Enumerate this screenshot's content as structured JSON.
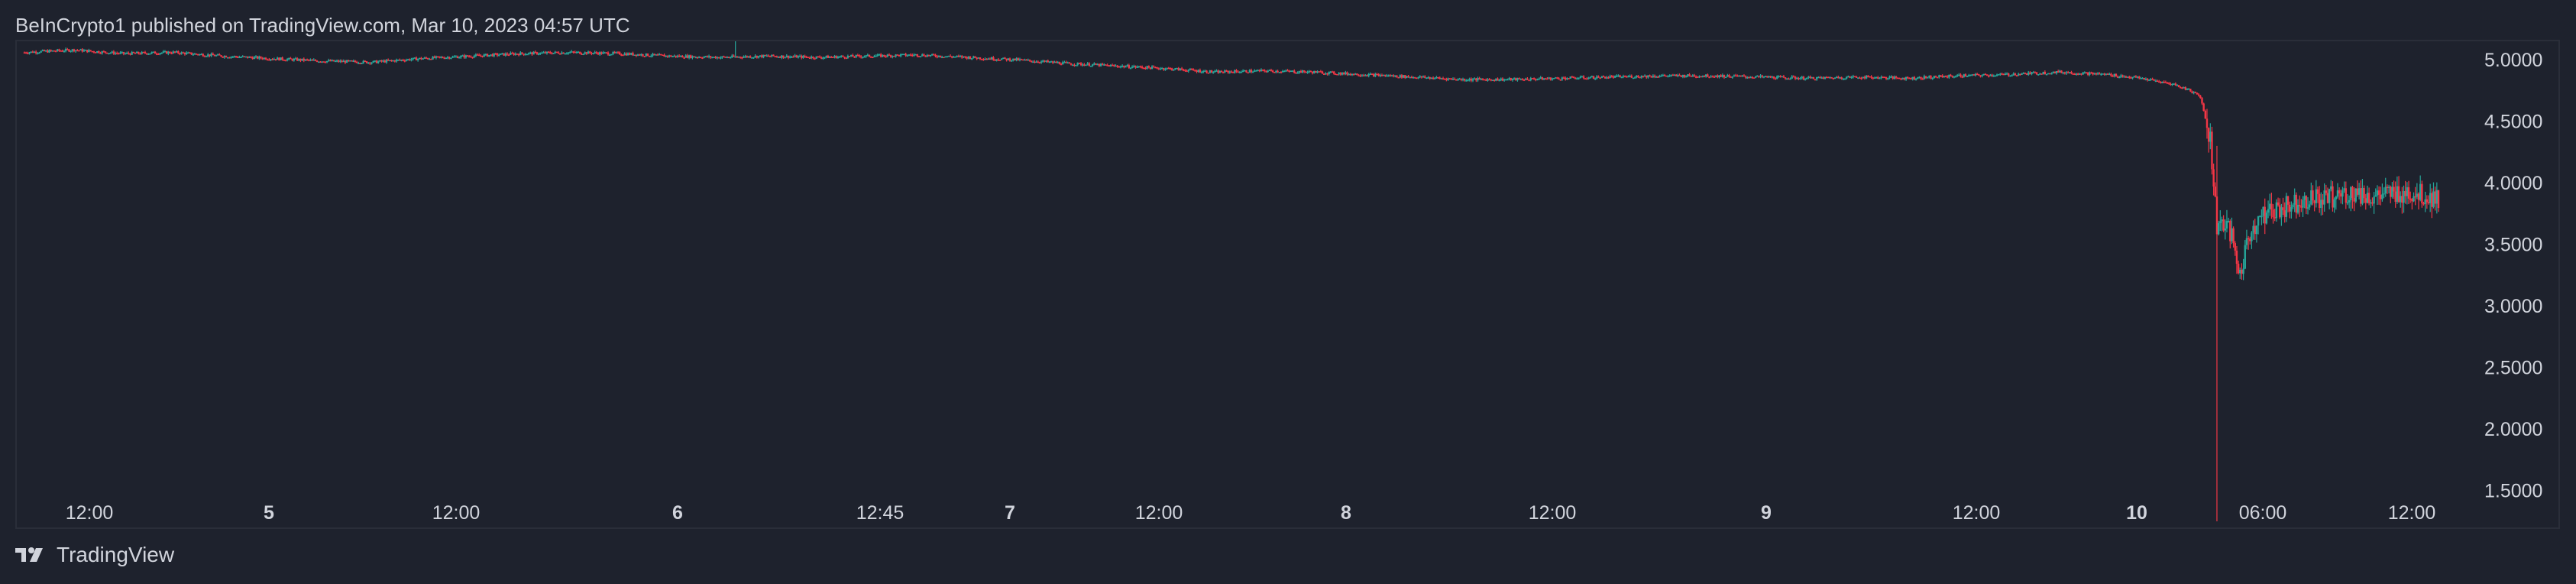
{
  "header": {
    "published_line": "BeInCrypto1 published on TradingView.com, Mar 10, 2023 04:57 UTC"
  },
  "footer": {
    "brand": "TradingView"
  },
  "colors": {
    "background": "#1e222d",
    "up": "#26a69a",
    "down": "#f23645",
    "text": "#d1d4dc",
    "grid_border": "#2a2e39"
  },
  "chart_data": {
    "type": "candlestick",
    "title": "",
    "y_axis_side": "right",
    "ylim": [
      1.2,
      5.15
    ],
    "y_ticks": [
      "5.0000",
      "4.5000",
      "4.0000",
      "3.5000",
      "3.0000",
      "2.5000",
      "2.0000",
      "1.5000"
    ],
    "x_ticks": [
      {
        "label": "12:00",
        "bold": false
      },
      {
        "label": "5",
        "bold": true
      },
      {
        "label": "12:00",
        "bold": false
      },
      {
        "label": "6",
        "bold": true
      },
      {
        "label": "12:45",
        "bold": false
      },
      {
        "label": "7",
        "bold": true
      },
      {
        "label": "12:00",
        "bold": false
      },
      {
        "label": "8",
        "bold": true
      },
      {
        "label": "12:00",
        "bold": false
      },
      {
        "label": "9",
        "bold": true
      },
      {
        "label": "12:00",
        "bold": false
      },
      {
        "label": "10",
        "bold": true
      },
      {
        "label": "06:00",
        "bold": false
      },
      {
        "label": "12:00",
        "bold": false
      }
    ],
    "price_path": [
      [
        0,
        5.06
      ],
      [
        30,
        5.08
      ],
      [
        60,
        5.05
      ],
      [
        90,
        5.06
      ],
      [
        120,
        5.03
      ],
      [
        150,
        5.01
      ],
      [
        180,
        4.99
      ],
      [
        210,
        4.98
      ],
      [
        240,
        5.01
      ],
      [
        270,
        5.03
      ],
      [
        300,
        5.05
      ],
      [
        330,
        5.06
      ],
      [
        360,
        5.05
      ],
      [
        390,
        5.03
      ],
      [
        420,
        5.02
      ],
      [
        450,
        5.03
      ],
      [
        480,
        5.02
      ],
      [
        510,
        5.03
      ],
      [
        540,
        5.04
      ],
      [
        570,
        5.02
      ],
      [
        600,
        5.0
      ],
      [
        630,
        4.97
      ],
      [
        660,
        4.95
      ],
      [
        690,
        4.93
      ],
      [
        720,
        4.9
      ],
      [
        750,
        4.91
      ],
      [
        780,
        4.9
      ],
      [
        810,
        4.88
      ],
      [
        840,
        4.86
      ],
      [
        870,
        4.84
      ],
      [
        900,
        4.84
      ],
      [
        930,
        4.85
      ],
      [
        960,
        4.86
      ],
      [
        990,
        4.87
      ],
      [
        1020,
        4.87
      ],
      [
        1050,
        4.86
      ],
      [
        1080,
        4.85
      ],
      [
        1110,
        4.86
      ],
      [
        1140,
        4.85
      ],
      [
        1170,
        4.87
      ],
      [
        1200,
        4.88
      ],
      [
        1230,
        4.9
      ],
      [
        1260,
        4.88
      ],
      [
        1280,
        4.85
      ],
      [
        1300,
        4.8
      ],
      [
        1310,
        4.75
      ],
      [
        1316,
        4.7
      ],
      [
        1322,
        4.35
      ],
      [
        1326,
        3.65
      ],
      [
        1330,
        3.7
      ],
      [
        1335,
        3.55
      ],
      [
        1340,
        3.25
      ],
      [
        1345,
        3.55
      ],
      [
        1350,
        3.7
      ],
      [
        1360,
        3.78
      ],
      [
        1370,
        3.82
      ],
      [
        1380,
        3.88
      ],
      [
        1390,
        3.87
      ],
      [
        1400,
        3.9
      ],
      [
        1410,
        3.92
      ],
      [
        1420,
        3.88
      ],
      [
        1430,
        3.9
      ],
      [
        1440,
        3.93
      ],
      [
        1450,
        3.9
      ],
      [
        1460,
        3.87
      ]
    ],
    "notable_wicks": [
      {
        "x": 430,
        "high": 5.27,
        "low": 5.02
      },
      {
        "x": 1326,
        "high": 4.3,
        "low": 1.25
      }
    ]
  }
}
